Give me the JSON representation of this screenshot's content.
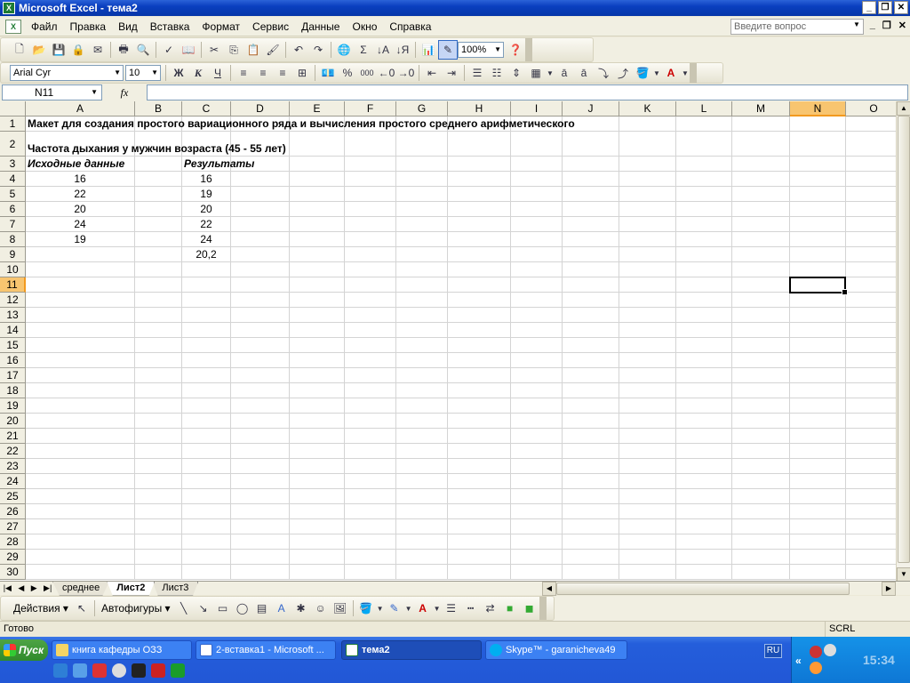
{
  "window": {
    "title": "Microsoft Excel - тема2",
    "app_icon": "X"
  },
  "menu": {
    "items": [
      "Файл",
      "Правка",
      "Вид",
      "Вставка",
      "Формат",
      "Сервис",
      "Данные",
      "Окно",
      "Справка"
    ],
    "help_placeholder": "Введите вопрос"
  },
  "toolbar": {
    "zoom": "100%",
    "font_name": "Arial Cyr",
    "font_size": "10",
    "bold_label": "Ж",
    "italic_label": "К",
    "underline_label": "Ч",
    "sum_label": "Σ",
    "percent_label": "%",
    "thousands_label": "000"
  },
  "formula_bar": {
    "name_box": "N11",
    "fx_label": "fx",
    "formula": ""
  },
  "sheet": {
    "columns": [
      "A",
      "B",
      "C",
      "D",
      "E",
      "F",
      "G",
      "H",
      "I",
      "J",
      "K",
      "L",
      "M",
      "N",
      "O"
    ],
    "selected_column": "N",
    "row_numbers": [
      "1",
      "2",
      "3",
      "4",
      "5",
      "6",
      "7",
      "8",
      "9",
      "10",
      "11",
      "12",
      "13",
      "14",
      "15",
      "16",
      "17",
      "18",
      "19",
      "20",
      "21",
      "22",
      "23",
      "24",
      "25",
      "26",
      "27",
      "28",
      "29",
      "30"
    ],
    "selected_row": "11",
    "cells": {
      "A1": "Макет для создания простого вариационного ряда и вычисления простого среднего арифметического",
      "A2": "Частота дыхания у мужчин возраста (45 - 55 лет)",
      "A3": "Исходные данные",
      "C3": "Результаты",
      "A4": "16",
      "C4": "16",
      "A5": "22",
      "C5": "19",
      "A6": "20",
      "C6": "20",
      "A7": "24",
      "C7": "22",
      "A8": "19",
      "C8": "24",
      "C9": "20,2"
    }
  },
  "tabs": {
    "items": [
      "среднее",
      "Лист2",
      "Лист3"
    ],
    "active": "Лист2"
  },
  "drawing": {
    "actions_label": "Действия",
    "autoshapes_label": "Автофигуры"
  },
  "status": {
    "text": "Готово",
    "scrl": "SCRL"
  },
  "taskbar": {
    "start_label": "Пуск",
    "tasks": [
      {
        "label": "книга кафедры ОЗЗ"
      },
      {
        "label": "2-вставка1 - Microsoft ..."
      },
      {
        "label": "тема2"
      },
      {
        "label": "Skype™ - garanicheva49"
      }
    ],
    "lang": "RU",
    "clock": "15:34"
  },
  "colors": {
    "title_blue": "#0a3fbf",
    "selected_header": "#f8c570",
    "taskbar_blue": "#245edb"
  }
}
